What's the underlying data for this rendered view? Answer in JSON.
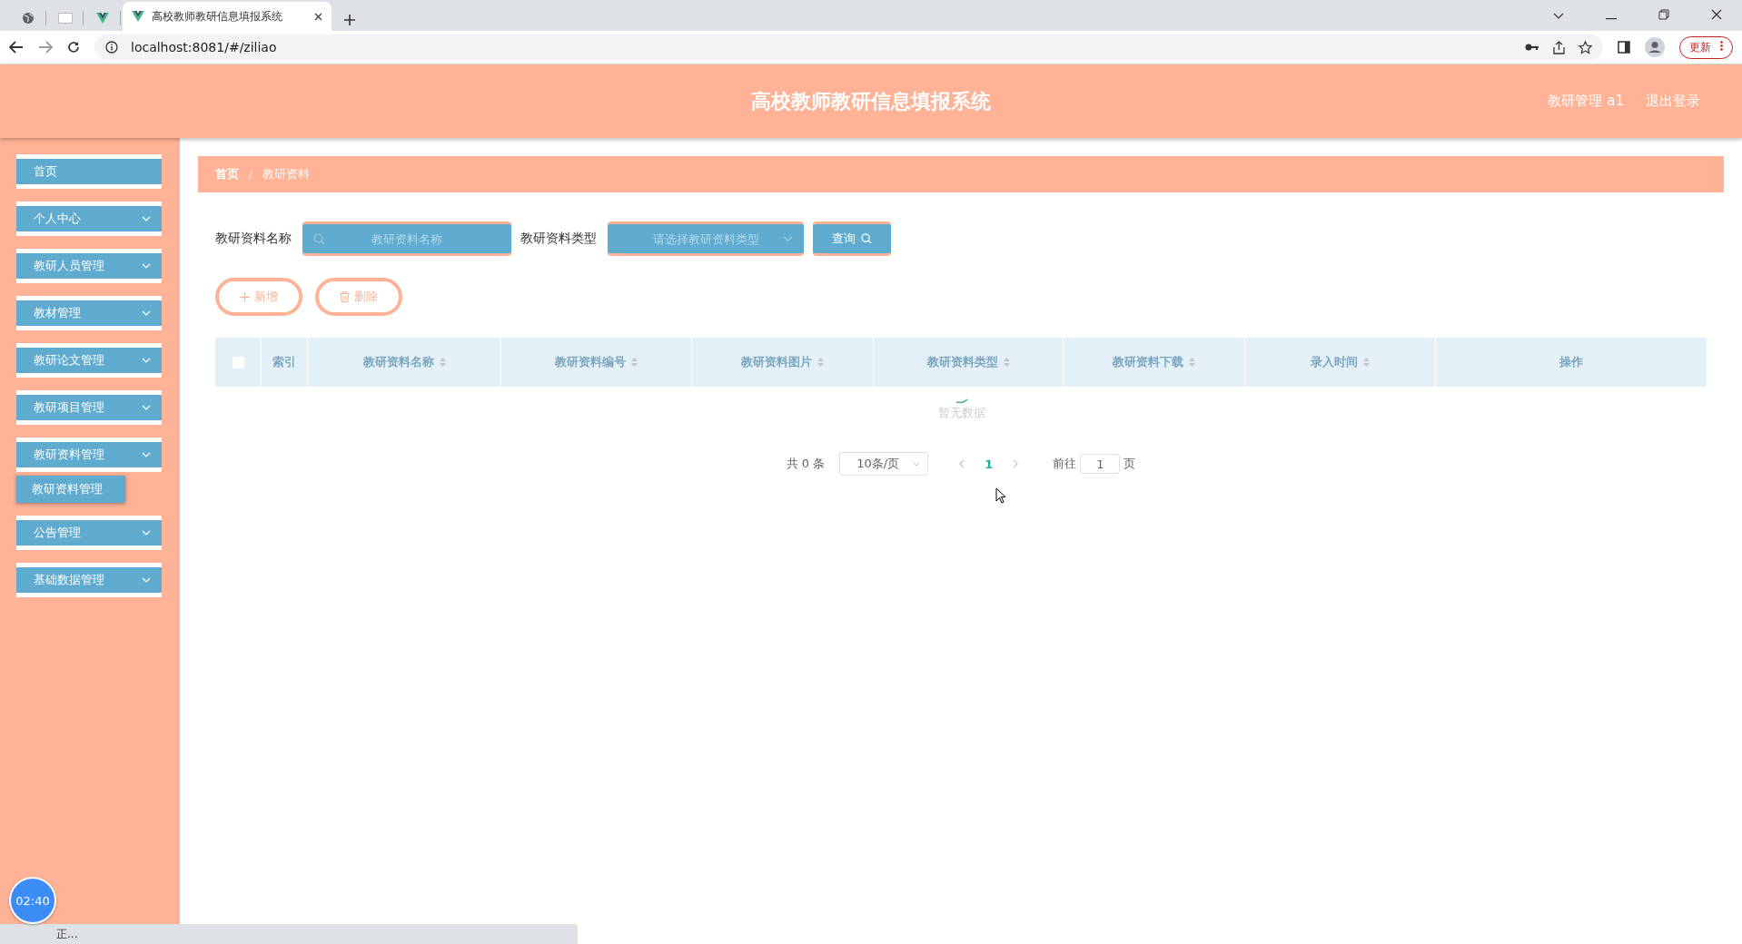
{
  "browser": {
    "tabs": [
      {
        "kind": "globe",
        "selected": false
      },
      {
        "kind": "blank",
        "selected": false
      },
      {
        "kind": "vue",
        "selected": false
      },
      {
        "kind": "vue",
        "title": "高校教师教研信息填报系统",
        "selected": true
      }
    ],
    "url": "localhost:8081/#/ziliao",
    "update_label": "更新"
  },
  "header": {
    "title": "高校教师教研信息填报系统",
    "user": "教研管理 a1",
    "logout": "退出登录"
  },
  "sidebar": {
    "items": [
      {
        "label": "首页",
        "expandable": false
      },
      {
        "label": "个人中心",
        "expandable": true
      },
      {
        "label": "教研人员管理",
        "expandable": true
      },
      {
        "label": "教材管理",
        "expandable": true
      },
      {
        "label": "教研论文管理",
        "expandable": true
      },
      {
        "label": "教研项目管理",
        "expandable": true
      },
      {
        "label": "教研资料管理",
        "expandable": true,
        "children": [
          {
            "label": "教研资料管理"
          }
        ]
      },
      {
        "label": "公告管理",
        "expandable": true
      },
      {
        "label": "基础数据管理",
        "expandable": true
      }
    ]
  },
  "breadcrumb": [
    "首页",
    "教研资料"
  ],
  "search": {
    "fields": [
      {
        "kind": "text",
        "label": "教研资料名称",
        "placeholder": "教研资料名称"
      },
      {
        "kind": "select",
        "label": "教研资料类型",
        "placeholder": "请选择教研资料类型"
      }
    ],
    "query_button": "查询"
  },
  "actions": [
    {
      "kind": "add",
      "label": "新增"
    },
    {
      "kind": "delete",
      "label": "删除"
    }
  ],
  "table": {
    "select_all": {
      "checked": false
    },
    "columns": [
      {
        "label": "索引",
        "sortable": false
      },
      {
        "label": "教研资料名称",
        "sortable": true
      },
      {
        "label": "教研资料编号",
        "sortable": true
      },
      {
        "label": "教研资料图片",
        "sortable": true
      },
      {
        "label": "教研资料类型",
        "sortable": true
      },
      {
        "label": "教研资料下载",
        "sortable": true
      },
      {
        "label": "录入时间",
        "sortable": true
      },
      {
        "label": "操作",
        "sortable": false
      }
    ],
    "empty_text": "暂无数据"
  },
  "pagination": {
    "total": "共 0 条",
    "page_size": "10条/页",
    "pages": [
      {
        "label": "1",
        "selected": true
      }
    ],
    "goto_label": "前往",
    "goto_value": "1",
    "page_suffix": "页"
  },
  "status_bar": {
    "text": "正..."
  },
  "timer": "02:40"
}
